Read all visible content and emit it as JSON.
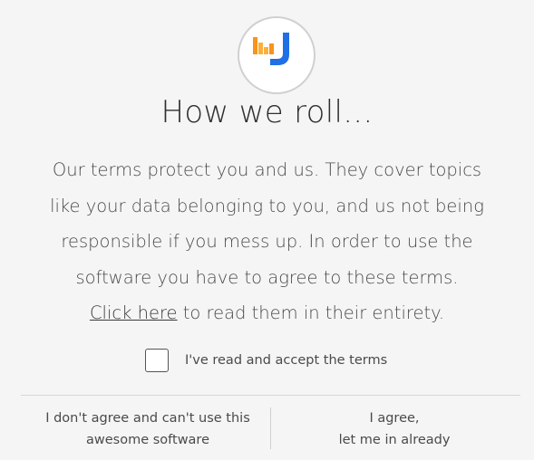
{
  "logo": {
    "icon": "app-logo-icon",
    "colors": {
      "orange": "#f7931e",
      "yellow": "#fbb03b",
      "blue": "#1f6fe5"
    }
  },
  "title": "How we roll...",
  "body": {
    "line1": "Our terms protect you and us. They cover topics",
    "line2": "like your data belonging to you, and us not being",
    "line3": "responsible if you mess up. In order to use the",
    "line4": "software you have to agree to these terms.",
    "link_text": "Click here",
    "link_suffix": " to read them in their entirety."
  },
  "checkbox": {
    "label": "I've read and accept the terms",
    "checked": false
  },
  "buttons": {
    "decline_line1": "I don't agree and can't use this",
    "decline_line2": "awesome software",
    "agree_line1": "I agree,",
    "agree_line2": "let me in already"
  }
}
